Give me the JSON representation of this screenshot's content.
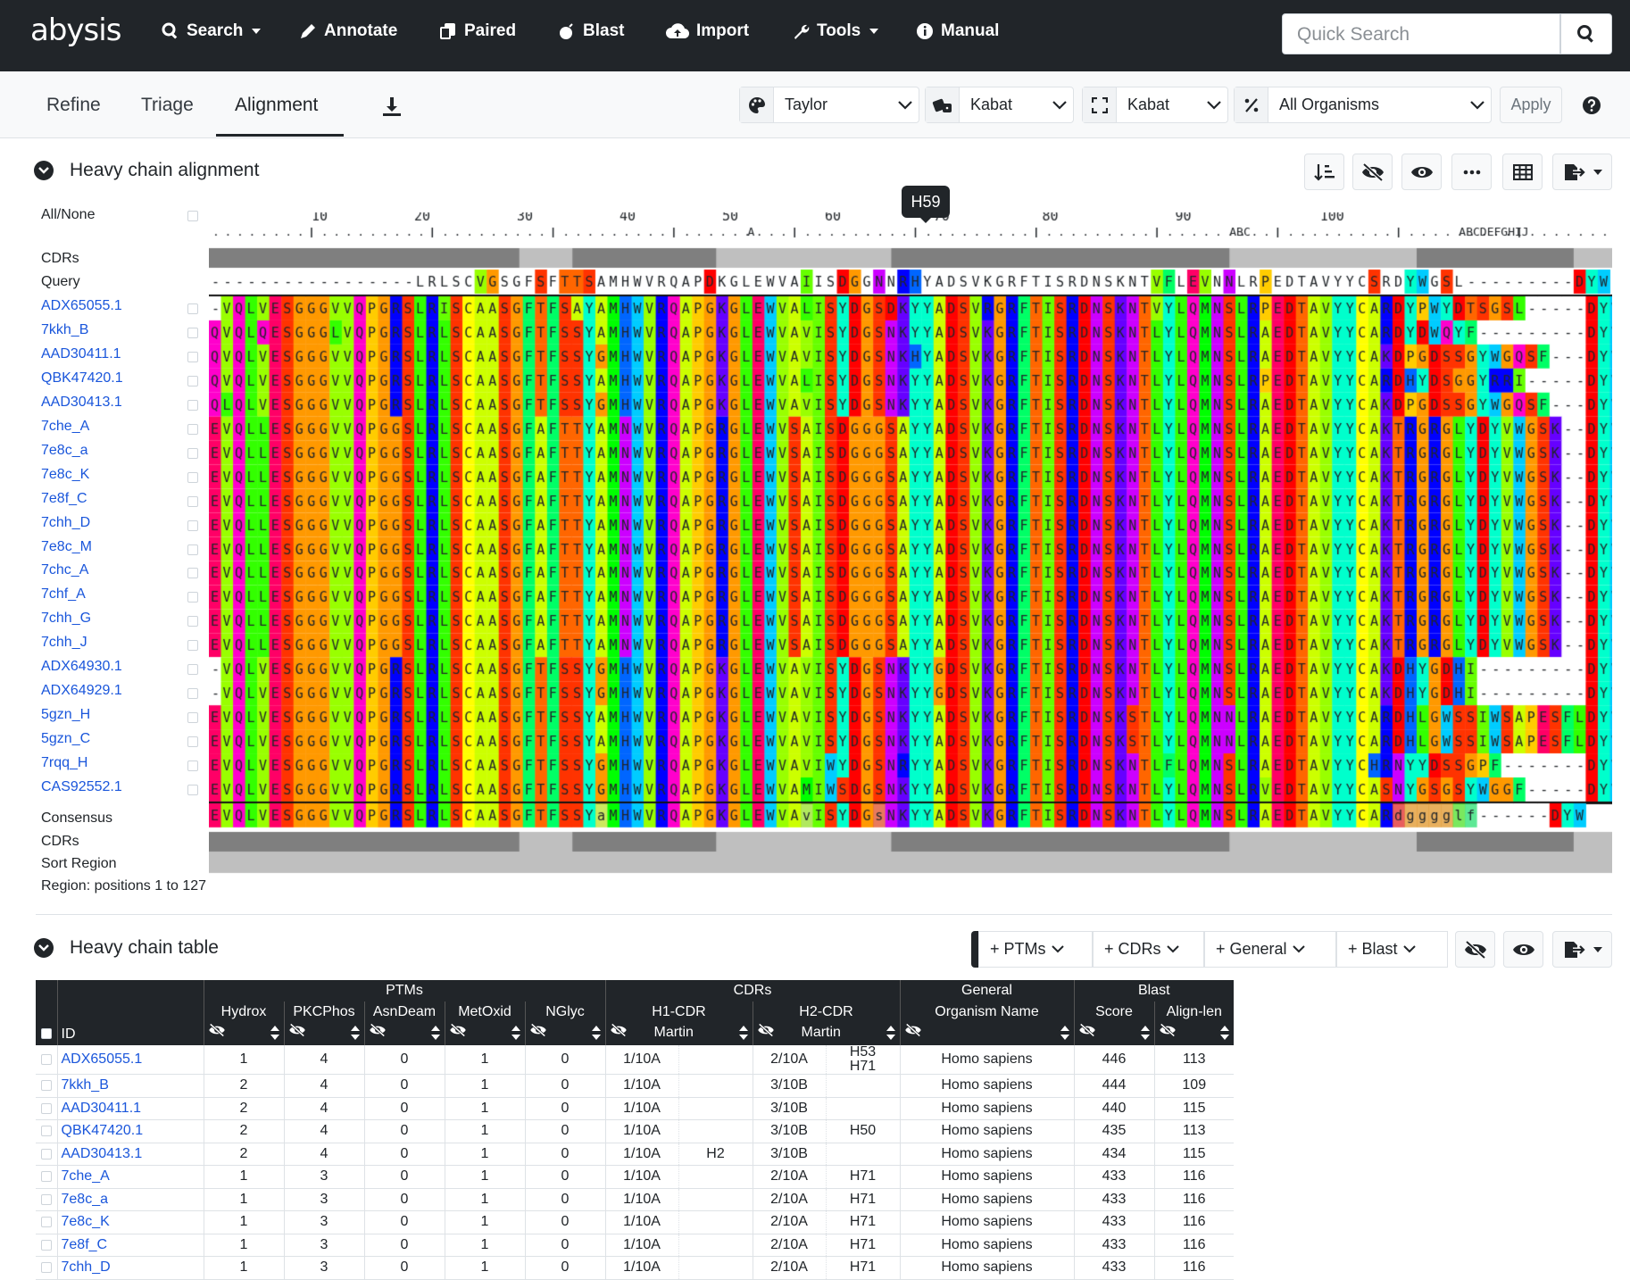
{
  "nav": {
    "brand": "abysis",
    "items": [
      {
        "label": "Search",
        "icon": "search-icon",
        "dropdown": true
      },
      {
        "label": "Annotate",
        "icon": "pen-icon",
        "dropdown": false
      },
      {
        "label": "Paired",
        "icon": "copy-icon",
        "dropdown": false
      },
      {
        "label": "Blast",
        "icon": "bomb-icon",
        "dropdown": false
      },
      {
        "label": "Import",
        "icon": "cloud-upload-icon",
        "dropdown": false
      },
      {
        "label": "Tools",
        "icon": "wrench-icon",
        "dropdown": true
      },
      {
        "label": "Manual",
        "icon": "info-icon",
        "dropdown": false
      }
    ],
    "quick_search_placeholder": "Quick Search"
  },
  "subnav": {
    "tabs": [
      "Refine",
      "Triage",
      "Alignment"
    ],
    "active_tab": "Alignment",
    "color_scheme": "Taylor",
    "numbering": "Kabat",
    "region": "Kabat",
    "organism": "All Organisms",
    "apply": "Apply"
  },
  "alignment": {
    "title": "Heavy chain alignment",
    "all_none": "All/None",
    "tooltip": "H59",
    "ruler_numbers": [
      "10",
      "20",
      "30",
      "40",
      "50",
      "60",
      "70",
      "80",
      "90",
      "100"
    ],
    "ruler_inserts": [
      "A",
      "ABC",
      "ABCDEFGHIJ"
    ],
    "labels": {
      "cdrs_top": "CDRs",
      "query": "Query",
      "consensus": "Consensus",
      "cdrs_bottom": "CDRs",
      "sort_region": "Sort Region"
    },
    "region_text": "Region: positions 1 to 127",
    "query_seq": "-----------------LRLSCVGSGFSFTTSAMHWVRQAPDKGLEWVAIISDGGNNRHYADSVKGRFTISRDNSKNTVFLEVNNLRPEDTAVYYCSRDYWGSL---------DYW",
    "rows": [
      {
        "id": "ADX65055.1",
        "seq": "-VQLVESGGGVVQPGRSLRISCAASGFTFSAYAMHWVRQAPGKGLEWVALISYDGSDKYYADSVRGRFTISRDNSKNTVYLQMNSLRPEDTAVYYCARDYPWYDTSGSL-----DYW"
      },
      {
        "id": "7kkh_B",
        "seq": "QVQLQESGGGLVQPGRSLRLSCAASGFTFSSYAMHWVRQAPGKGLEWVAVISYDGSNKYYADSVKGRFTISRDNSKNTLYLQMNSLRAEDTAVYYCARDYDWQYF---------DYW"
      },
      {
        "id": "AAD30411.1",
        "seq": "QVQLVESGGGVVQPGRSLRLSCAASGFTFSSYGMHWVRQAPGKGLEWVAVISYDGSNKHYADSVKGRFTISRDNSKNTLYLQMNSLRAEDTAVYYCAKDPGDSSGYWGQSF---DYW"
      },
      {
        "id": "QBK47420.1",
        "seq": "QVQLVESGGGVVQPGRSLRLSCAASGFTFSSYAMHWVRQAPGKGLEWVALISYDGSNKYYADSVKGRFTISRDNSKNTLYLQMNSLRPEDTAVYYCARDHYDSGGYRRI-----DYW"
      },
      {
        "id": "AAD30413.1",
        "seq": "QLQLVESGGGVVQPGRSLRLSCAASGFTFSSYGMHWVRQAPGKGLEWVAVISYDGSNKYYADSVKGRFTISRDNSKNTLYLQMNSLRAEDTAVYYCAKDPGDSSGYWGQSF---DYW"
      },
      {
        "id": "7che_A",
        "seq": "EVQLLESGGGVVQPGGSLRLSCAASGFAFTTYAMNWVRQAPGRGLEWVSAISDGGGSAYYADSVKGRFTISRDNSKNTLYLQMNSLRAEDTAVYYCAKTRGRGLYDYVWGSK--DYW"
      },
      {
        "id": "7e8c_a",
        "seq": "EVQLLESGGGVVQPGGSLRLSCAASGFAFTTYAMNWVRQAPGRGLEWVSAISDGGGSAYYADSVKGRFTISRDNSKNTLYLQMNSLRAEDTAVYYCAKTRGRGLYDYVWGSK--DYW"
      },
      {
        "id": "7e8c_K",
        "seq": "EVQLLESGGGVVQPGGSLRLSCAASGFAFTTYAMNWVRQAPGRGLEWVSAISDGGGSAYYADSVKGRFTISRDNSKNTLYLQMNSLRAEDTAVYYCAKTRGRGLYDYVWGSK--DYW"
      },
      {
        "id": "7e8f_C",
        "seq": "EVQLLESGGGVVQPGGSLRLSCAASGFAFTTYAMNWVRQAPGRGLEWVSAISDGGGSAYYADSVKGRFTISRDNSKNTLYLQMNSLRAEDTAVYYCAKTRGRGLYDYVWGSK--DYW"
      },
      {
        "id": "7chh_D",
        "seq": "EVQLLESGGGVVQPGGSLRLSCAASGFAFTTYAMNWVRQAPGRGLEWVSAISDGGGSAYYADSVKGRFTISRDNSKNTLYLQMNSLRAEDTAVYYCAKTRGRGLYDYVWGSK--DYW"
      },
      {
        "id": "7e8c_M",
        "seq": "EVQLLESGGGVVQPGGSLRLSCAASGFAFTTYAMNWVRQAPGRGLEWVSAISDGGGSAYYADSVKGRFTISRDNSKNTLYLQMNSLRAEDTAVYYCAKTRGRGLYDYVWGSK--DYW"
      },
      {
        "id": "7chc_A",
        "seq": "EVQLLESGGGVVQPGGSLRLSCAASGFAFTTYAMNWVRQAPGRGLEWVSAISDGGGSAYYADSVKGRFTISRDNSKNTLYLQMNSLRAEDTAVYYCAKTRGRGLYDYVWGSK--DYW"
      },
      {
        "id": "7chf_A",
        "seq": "EVQLLESGGGVVQPGGSLRLSCAASGFAFTTYAMNWVRQAPGRGLEWVSAISDGGGSAYYADSVKGRFTISRDNSKNTLYLQMNSLRAEDTAVYYCAKTRGRGLYDYVWGSK--DYW"
      },
      {
        "id": "7chh_G",
        "seq": "EVQLLESGGGVVQPGGSLRLSCAASGFAFTTYAMNWVRQAPGRGLEWVSAISDGGGSAYYADSVKGRFTISRDNSKNTLYLQMNSLRAEDTAVYYCAKTRGRGLYDYVWGSK--DYW"
      },
      {
        "id": "7chh_J",
        "seq": "EVQLLESGGGVVQPGGSLRLSCAASGFAFTTYAMNWVRQAPGRGLEWVSAISDGGGSAYYADSVKGRFTISRDNSKNTLYLQMNSLRAEDTAVYYCAKTRGRGLYDYVWGSK--DYW"
      },
      {
        "id": "ADX64930.1",
        "seq": "-VQLVESGGGVVQPGRSLRLSCAASGFTFSSYGMHWVRQAPGKGLEWVAVISYDGSNKYYGDSVKGRFTISRDNSKNTLYLQMNSLRAEDTAVYYCAKDHYGDHI---------DYW"
      },
      {
        "id": "ADX64929.1",
        "seq": "-VQLVESGGGVVQPGRSLRLSCAASGFTFSSYGMHWVRQAPGKGLEWVAVISYDGSNKYYGDSVKGRFTISRDNSKNTLYLQMNSLRAEDTAVYYCAKDHYGDHI---------DYW"
      },
      {
        "id": "5gzn_H",
        "seq": "EVQLVESGGGVVQPGRSLRLSCAASGFTFSSYAMHWVRQAPGKGLEWVAVISYDGSNKYYADSVKGRFTISRDNSKSTLYLQMNNLRAEDTAVYYCARDHLGWSSIWSAPESFLDYW"
      },
      {
        "id": "5gzn_C",
        "seq": "EVQLVESGGGVVQPGRSLRLSCAASGFTFSSYAMHWVRQAPGKGLEWVAVISYDGSNKYYADSVKGRFTISRDNSKSTLYLQMNNLRAEDTAVYYCARDHLGWSSIWSAPESFLDYW"
      },
      {
        "id": "7rqq_H",
        "seq": "EVQLVESGGGVVQPGRSLRLSCAASGFTFSSYGMHWVRQAPGKGLEWVAVIWYDGSNRYYADSVKGRFTISRDNSKNTLFLQMNSLRAEDTAVYYCHRNYYDSSGPF-------DYW"
      },
      {
        "id": "CAS92552.1",
        "seq": "EVQLVESGGGVVQPGRSLRLSCAASGFTFSSYGMHWVRQAPGKGLEWVAMIWSDGSNKYYADSVKGRFTISRDNSKNTLYLQMNSLRVEDTAVYYCASNYGSGSYWGGF-----DYW"
      }
    ],
    "consensus_seq": "EVQLVESGGGVVQPGRSLRLSCAASGFTFSSYaMHWVRQAPGKGLEWVAvISYDGsNKYYADSVKGRFTISRDNSKNTLYLQMNSLRAEDTAVYYCARdgggglf------DYW"
  },
  "table": {
    "title": "Heavy chain table",
    "add_buttons": [
      "+ PTMs",
      "+ CDRs",
      "+ General",
      "+ Blast"
    ],
    "group_headers": [
      "PTMs",
      "CDRs",
      "General",
      "Blast"
    ],
    "col_headers": [
      "Hydrox",
      "PKCPhos",
      "AsnDeam",
      "MetOxid",
      "NGlyc",
      "H1-CDR",
      "H2-CDR",
      "Organism Name",
      "Score",
      "Align-len"
    ],
    "cdr_sub": [
      "Martin",
      "Martin"
    ],
    "id_header": "ID",
    "rows": [
      {
        "id": "ADX65055.1",
        "v": [
          "1",
          "4",
          "0",
          "1",
          "0",
          "1/10A",
          "",
          "2/10A",
          "H53 H71",
          "Homo sapiens",
          "446",
          "113"
        ]
      },
      {
        "id": "7kkh_B",
        "v": [
          "2",
          "4",
          "0",
          "1",
          "0",
          "1/10A",
          "",
          "3/10B",
          "",
          "Homo sapiens",
          "444",
          "109"
        ]
      },
      {
        "id": "AAD30411.1",
        "v": [
          "2",
          "4",
          "0",
          "1",
          "0",
          "1/10A",
          "",
          "3/10B",
          "",
          "Homo sapiens",
          "440",
          "115"
        ]
      },
      {
        "id": "QBK47420.1",
        "v": [
          "2",
          "4",
          "0",
          "1",
          "0",
          "1/10A",
          "",
          "3/10B",
          "H50",
          "Homo sapiens",
          "435",
          "113"
        ]
      },
      {
        "id": "AAD30413.1",
        "v": [
          "2",
          "4",
          "0",
          "1",
          "0",
          "1/10A",
          "H2",
          "3/10B",
          "",
          "Homo sapiens",
          "434",
          "115"
        ]
      },
      {
        "id": "7che_A",
        "v": [
          "1",
          "3",
          "0",
          "1",
          "0",
          "1/10A",
          "",
          "2/10A",
          "H71",
          "Homo sapiens",
          "433",
          "116"
        ]
      },
      {
        "id": "7e8c_a",
        "v": [
          "1",
          "3",
          "0",
          "1",
          "0",
          "1/10A",
          "",
          "2/10A",
          "H71",
          "Homo sapiens",
          "433",
          "116"
        ]
      },
      {
        "id": "7e8c_K",
        "v": [
          "1",
          "3",
          "0",
          "1",
          "0",
          "1/10A",
          "",
          "2/10A",
          "H71",
          "Homo sapiens",
          "433",
          "116"
        ]
      },
      {
        "id": "7e8f_C",
        "v": [
          "1",
          "3",
          "0",
          "1",
          "0",
          "1/10A",
          "",
          "2/10A",
          "H71",
          "Homo sapiens",
          "433",
          "116"
        ]
      },
      {
        "id": "7chh_D",
        "v": [
          "1",
          "3",
          "0",
          "1",
          "0",
          "1/10A",
          "",
          "2/10A",
          "H71",
          "Homo sapiens",
          "433",
          "116"
        ]
      }
    ]
  },
  "colors": {
    "nav_bg": "#212529",
    "link": "#1a56db",
    "cdr_dark": "#7f7f7f",
    "cdr_light": "#bfbfbf"
  }
}
